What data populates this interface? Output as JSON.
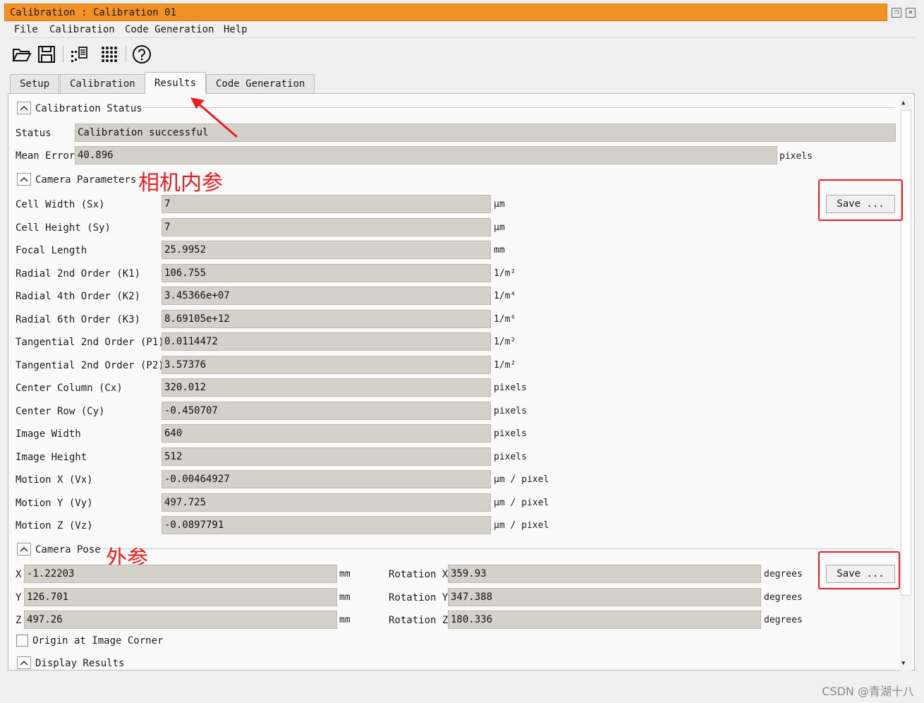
{
  "window": {
    "title": "Calibration : Calibration 01"
  },
  "menu": {
    "file": "File",
    "calibration": "Calibration",
    "code_generation": "Code Generation",
    "help": "Help"
  },
  "tabs": [
    "Setup",
    "Calibration",
    "Results",
    "Code Generation"
  ],
  "status_section": {
    "title": "Calibration Status",
    "status_label": "Status",
    "status_value": "Calibration successful",
    "mean_error_label": "Mean Error",
    "mean_error_value": "40.896",
    "mean_error_unit": "pixels"
  },
  "camera_params": {
    "title": "Camera Parameters",
    "annotation": "相机内参",
    "save_label": "Save ...",
    "rows": [
      {
        "label": "Cell Width (Sx)",
        "value": "7",
        "unit": "μm"
      },
      {
        "label": "Cell Height (Sy)",
        "value": "7",
        "unit": "μm"
      },
      {
        "label": "Focal Length",
        "value": "25.9952",
        "unit": "mm"
      },
      {
        "label": "Radial 2nd Order (K1)",
        "value": "106.755",
        "unit": "1/m²"
      },
      {
        "label": "Radial 4th Order (K2)",
        "value": "3.45366e+07",
        "unit": "1/m⁴"
      },
      {
        "label": "Radial 6th Order (K3)",
        "value": "8.69105e+12",
        "unit": "1/m⁶"
      },
      {
        "label": "Tangential 2nd Order (P1)",
        "value": "0.0114472",
        "unit": "1/m²"
      },
      {
        "label": "Tangential 2nd Order (P2)",
        "value": "3.57376",
        "unit": "1/m²"
      },
      {
        "label": "Center Column (Cx)",
        "value": "320.012",
        "unit": "pixels"
      },
      {
        "label": "Center Row (Cy)",
        "value": "-0.450707",
        "unit": "pixels"
      },
      {
        "label": "Image Width",
        "value": "640",
        "unit": "pixels"
      },
      {
        "label": "Image Height",
        "value": "512",
        "unit": "pixels"
      },
      {
        "label": "Motion X (Vx)",
        "value": "-0.00464927",
        "unit": "μm / pixel"
      },
      {
        "label": "Motion Y (Vy)",
        "value": "497.725",
        "unit": "μm / pixel"
      },
      {
        "label": "Motion Z (Vz)",
        "value": "-0.0897791",
        "unit": "μm / pixel"
      }
    ]
  },
  "camera_pose": {
    "title": "Camera Pose",
    "annotation": "外参",
    "save_label": "Save ...",
    "positions": [
      {
        "label": "X",
        "value": "-1.22203",
        "unit": "mm"
      },
      {
        "label": "Y",
        "value": "126.701",
        "unit": "mm"
      },
      {
        "label": "Z",
        "value": "497.26",
        "unit": "mm"
      }
    ],
    "rotations": [
      {
        "label": "Rotation X",
        "value": "359.93",
        "unit": "degrees"
      },
      {
        "label": "Rotation Y",
        "value": "347.388",
        "unit": "degrees"
      },
      {
        "label": "Rotation Z",
        "value": "180.336",
        "unit": "degrees"
      }
    ],
    "origin_checkbox_label": "Origin at Image Corner",
    "origin_checked": false
  },
  "display_section": {
    "title": "Display Results"
  },
  "watermark": "CSDN @青湖十八",
  "colors": {
    "title_bar": "#f29226",
    "field_bg": "#d4d0ca",
    "annotation_red": "#ee1c1c"
  },
  "icons": [
    "folder-open-icon",
    "save-icon",
    "code-icon",
    "calibration-plate-icon",
    "help-icon"
  ]
}
